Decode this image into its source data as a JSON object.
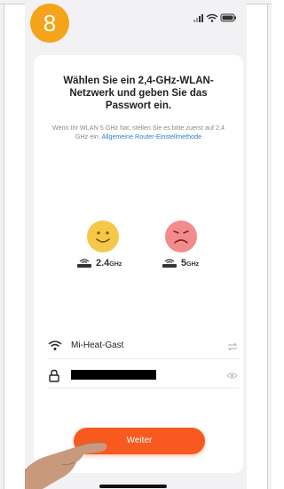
{
  "step": {
    "number": "8"
  },
  "status_bar": {
    "icons": [
      "signal-icon",
      "wifi-icon",
      "battery-icon"
    ]
  },
  "card": {
    "title": "Wählen Sie ein 2,4-GHz-WLAN-Netzwerk und geben Sie das Passwort ein.",
    "subtitle_text": "Wenn Ihr WLAN 5 GHz hat, stellen Sie es bitte zuerst auf 2,4 GHz ein.",
    "subtitle_link": "Allgemeine Router-Einstellmethode"
  },
  "bands": [
    {
      "value": "2.4",
      "unit": "GHz",
      "mood": "happy",
      "color": "#f5c84a"
    },
    {
      "value": "5",
      "unit": "GHz",
      "mood": "sad",
      "color": "#f28c8c"
    }
  ],
  "wifi": {
    "ssid": "Mi-Heat-Gast",
    "password_redacted": true
  },
  "buttons": {
    "next": "Weiter"
  },
  "colors": {
    "accent": "#f7591f",
    "badge": "#f5a31a",
    "link": "#2a7fd6"
  }
}
